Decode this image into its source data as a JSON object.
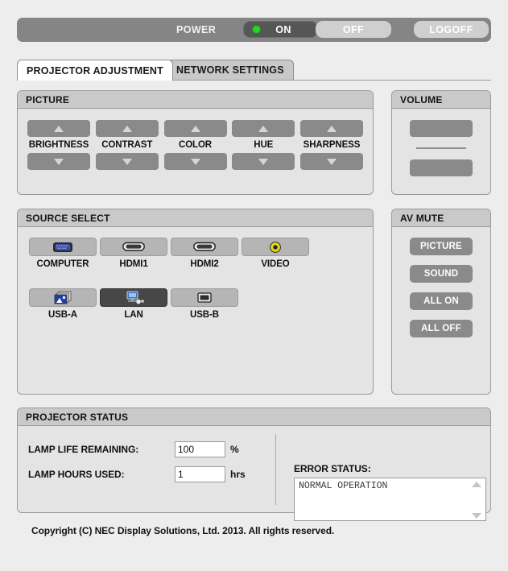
{
  "power_bar": {
    "label": "POWER",
    "on_label": "ON",
    "off_label": "OFF",
    "logoff_label": "LOGOFF",
    "led_color": "#1fdb1f",
    "power_state": "ON"
  },
  "tabs": [
    {
      "label": "PROJECTOR ADJUSTMENT",
      "active": true
    },
    {
      "label": "NETWORK SETTINGS",
      "active": false
    }
  ],
  "picture": {
    "title": "PICTURE",
    "controls": [
      {
        "label": "BRIGHTNESS",
        "up_icon": "triangle-up-icon",
        "down_icon": "triangle-down-icon"
      },
      {
        "label": "CONTRAST",
        "up_icon": "triangle-up-icon",
        "down_icon": "triangle-down-icon"
      },
      {
        "label": "COLOR",
        "up_icon": "triangle-up-icon",
        "down_icon": "triangle-down-icon"
      },
      {
        "label": "HUE",
        "up_icon": "triangle-up-icon",
        "down_icon": "triangle-down-icon"
      },
      {
        "label": "SHARPNESS",
        "up_icon": "triangle-up-icon",
        "down_icon": "triangle-down-icon"
      }
    ]
  },
  "volume": {
    "title": "VOLUME",
    "up_icon": "triangle-up-icon",
    "down_icon": "triangle-down-icon"
  },
  "source_select": {
    "title": "SOURCE SELECT",
    "selected": "LAN",
    "row1": [
      {
        "label": "COMPUTER",
        "icon": "vga-connector-icon",
        "selected": false
      },
      {
        "label": "HDMI1",
        "icon": "hdmi-connector-icon",
        "selected": false
      },
      {
        "label": "HDMI2",
        "icon": "hdmi-connector-icon",
        "selected": false
      },
      {
        "label": "VIDEO",
        "icon": "rca-composite-icon",
        "selected": false
      }
    ],
    "row2": [
      {
        "label": "USB-A",
        "icon": "usb-a-images-icon",
        "selected": false
      },
      {
        "label": "LAN",
        "icon": "lan-network-icon",
        "selected": true
      },
      {
        "label": "USB-B",
        "icon": "usb-b-port-icon",
        "selected": false
      }
    ]
  },
  "av_mute": {
    "title": "AV MUTE",
    "buttons": [
      "PICTURE",
      "SOUND",
      "ALL ON",
      "ALL OFF"
    ]
  },
  "projector_status": {
    "title": "PROJECTOR STATUS",
    "lamp_life_label": "LAMP LIFE REMAINING:",
    "lamp_life_value": "100",
    "lamp_life_unit": "%",
    "lamp_hours_label": "LAMP HOURS USED:",
    "lamp_hours_value": "1",
    "lamp_hours_unit": "hrs",
    "error_status_label": "ERROR STATUS:",
    "error_status_value": "NORMAL OPERATION"
  },
  "footer": {
    "copyright": "Copyright (C) NEC Display Solutions, Ltd. 2013. All rights reserved."
  }
}
